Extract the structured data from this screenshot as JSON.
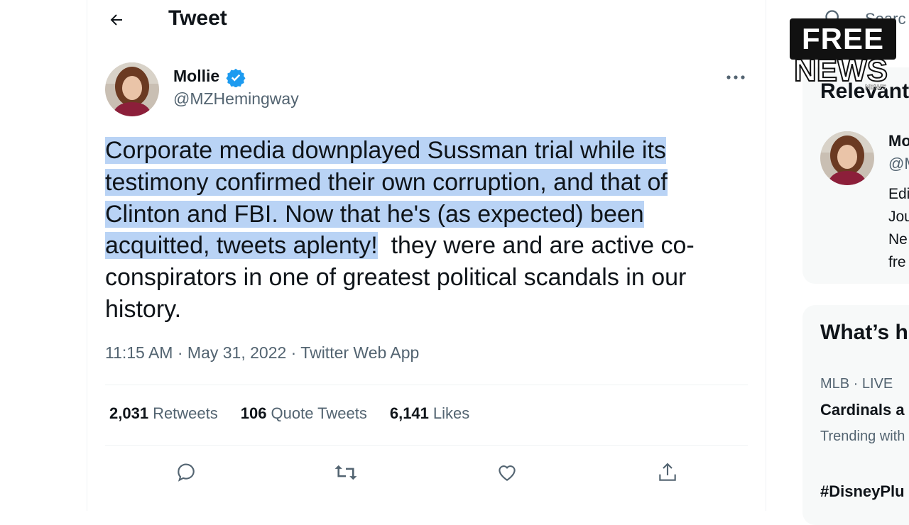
{
  "header": {
    "title": "Tweet"
  },
  "author": {
    "name": "Mollie",
    "handle": "@MZHemingway"
  },
  "tweet": {
    "text_highlighted": "Corporate media downplayed Sussman trial while its testimony confirmed their own corruption, and that of Clinton and FBI. Now that he's (as expected) been acquitted, tweets aplenty!",
    "text_rest": "  they were and are active co-conspirators in one of greatest political scandals in our history.",
    "meta": "11:15 AM · May 31, 2022 · Twitter Web App"
  },
  "stats": {
    "retweets_count": "2,031",
    "retweets_label": "Retweets",
    "quotes_count": "106",
    "quotes_label": "Quote Tweets",
    "likes_count": "6,141",
    "likes_label": "Likes"
  },
  "sidebar": {
    "search_placeholder": "Searc",
    "relevant_title": "Relevant",
    "relevant_person": {
      "name": "Mo",
      "handle": "@M",
      "bio_lines": [
        "Edi",
        "Jou",
        "Ne",
        "fre"
      ]
    },
    "whats_happening_title": "What’s h",
    "trends": [
      {
        "meta": "MLB · LIVE",
        "title": "Cardinals a",
        "sub": "Trending with"
      },
      {
        "title": "#DisneyPlu"
      }
    ]
  },
  "watermark": {
    "line1": "FREE",
    "line2": "NEWS",
    "small": "NEWS"
  },
  "colors": {
    "highlight": "#b9d3f5",
    "verified": "#1d9bf0",
    "muted": "#536471"
  }
}
